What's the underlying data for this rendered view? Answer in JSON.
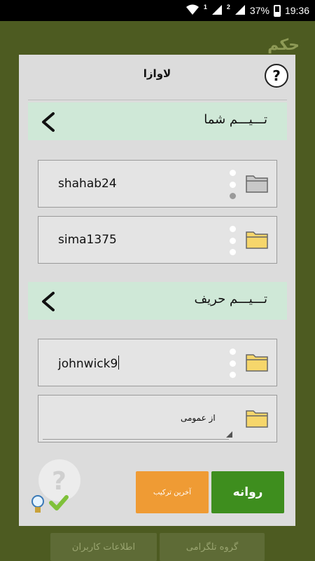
{
  "status_bar": {
    "signal_badge": "1",
    "notif_badge": "2",
    "battery": "37%",
    "time": "19:36"
  },
  "background": {
    "title": "حکم",
    "bottom_left": "اطلاعات کاربران",
    "bottom_right": "گروه تلگرامی"
  },
  "dialog": {
    "title": "لاوازا",
    "help": "?",
    "your_team": {
      "title": "تـــیـــم شما",
      "players": [
        {
          "name": "shahab24",
          "status": "grey"
        },
        {
          "name": "sima1375",
          "status": "white"
        }
      ]
    },
    "opponent_team": {
      "title": "تـــیـــم حریف",
      "players": [
        {
          "name": "johnwick9"
        }
      ],
      "select_value": "از عمومی"
    },
    "buttons": {
      "go": "روانه",
      "last_combo": "آخرین ترکیب"
    }
  },
  "colors": {
    "green_button": "#3e8e1e",
    "orange_button": "#ef9b34",
    "section_bar": "#cfe8d7",
    "folder_yellow": "#f6d66b"
  }
}
